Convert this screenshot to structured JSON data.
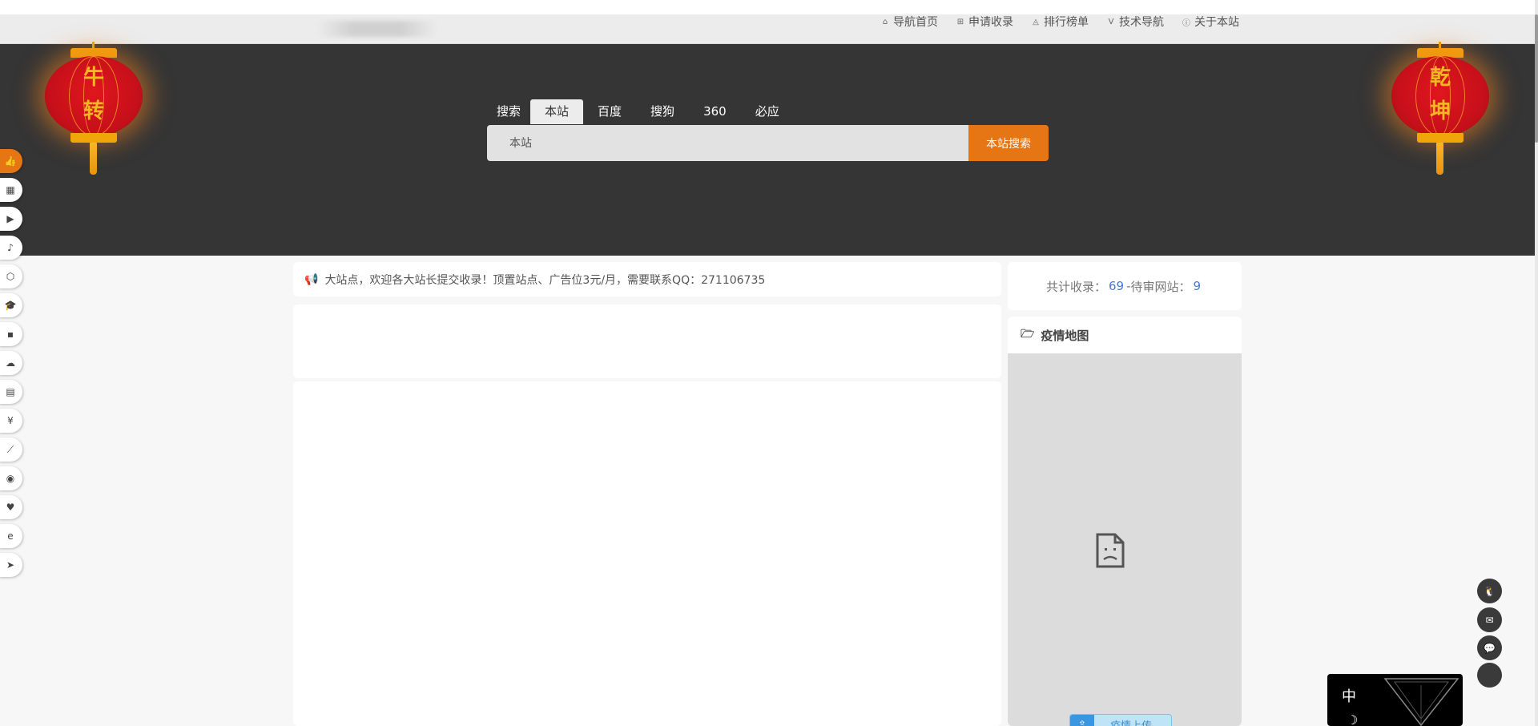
{
  "nav": {
    "items": [
      {
        "label": "导航首页",
        "icon": "home-icon"
      },
      {
        "label": "申请收录",
        "icon": "plus-square-icon"
      },
      {
        "label": "排行榜单",
        "icon": "ranking-icon"
      },
      {
        "label": "技术导航",
        "icon": "vimeo-icon"
      },
      {
        "label": "关于本站",
        "icon": "info-icon"
      }
    ]
  },
  "hero": {
    "lantern_left": [
      "牛",
      "转"
    ],
    "lantern_right": [
      "乾",
      "坤"
    ]
  },
  "search": {
    "tabs": [
      "搜索",
      "本站",
      "百度",
      "搜狗",
      "360",
      "必应"
    ],
    "active_tab": "本站",
    "placeholder": "本站",
    "button": "本站搜索"
  },
  "sidebar": {
    "icons": [
      "thumbs-up-icon",
      "store-icon",
      "youtube-icon",
      "music-icon",
      "cubes-icon",
      "graduation-cap-icon",
      "grid-icon",
      "cloud-icon",
      "document-icon",
      "yen-icon",
      "line-chart-icon",
      "compass-icon",
      "heartbeat-icon",
      "edge-icon",
      "paper-plane-icon"
    ]
  },
  "notice": {
    "text": "大站点，欢迎各大站长提交收录！顶置站点、广告位3元/月，需要联系QQ：271106735"
  },
  "stats": {
    "total_label": "共计收录：",
    "total": "69",
    "separator": " - ",
    "pending_label": "待审网站：",
    "pending": "9"
  },
  "map": {
    "title": "疫情地图",
    "upload_label": "疫情上传"
  },
  "float": {
    "icons": [
      "qq-icon",
      "mail-icon",
      "wechat-icon",
      "back-to-top-icon"
    ]
  },
  "widget": {
    "lang": "中"
  },
  "colors": {
    "accent": "#e67614",
    "hero_bg": "#353535",
    "link": "#4a78d9"
  }
}
